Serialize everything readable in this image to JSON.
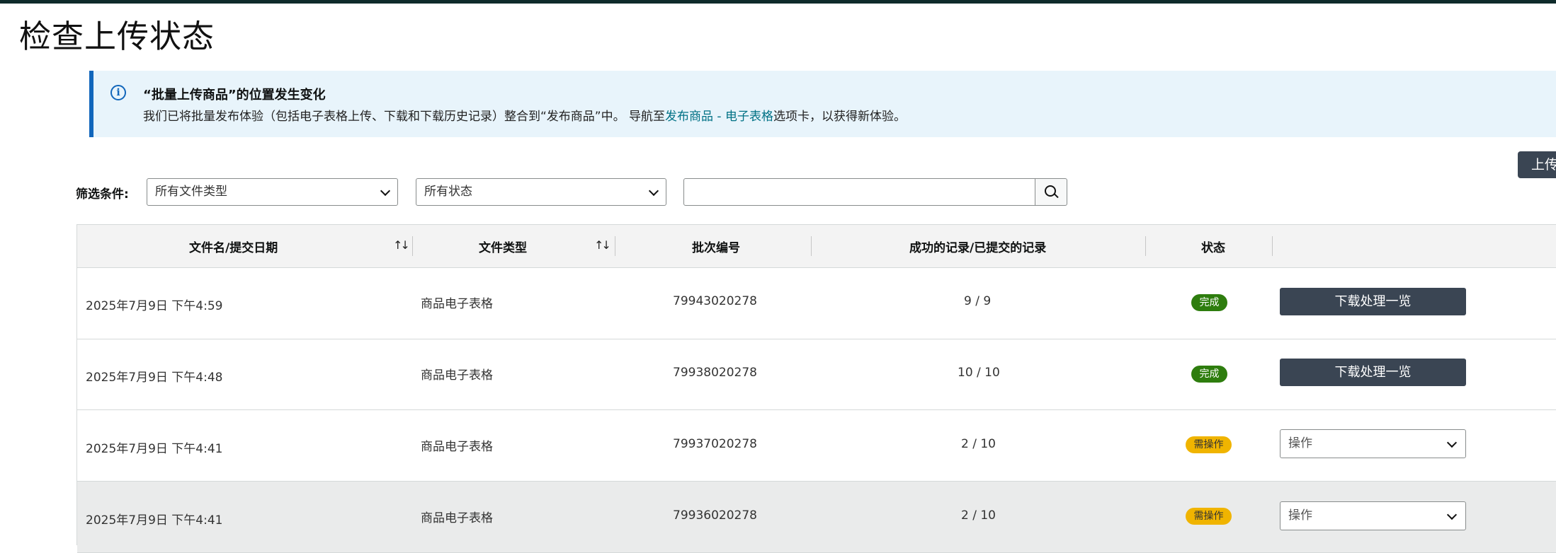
{
  "page": {
    "title": "检查上传状态"
  },
  "banner": {
    "icon": "info-icon",
    "title": "“批量上传商品”的位置发生变化",
    "text_before": "我们已将批量发布体验（包括电子表格上传、下载和下载历史记录）整合到“发布商品”中。 导航至",
    "link": "发布商品 - 电子表格",
    "text_after": "选项卡，以获得新体验。"
  },
  "toolbar": {
    "upload_label": "上传"
  },
  "filters": {
    "label": "筛选条件:",
    "file_type": "所有文件类型",
    "status": "所有状态",
    "search_value": ""
  },
  "table": {
    "headers": {
      "filename": "文件名/提交日期",
      "filetype": "文件类型",
      "batch": "批次编号",
      "records": "成功的记录/已提交的记录",
      "status": "状态"
    },
    "rows": [
      {
        "date": "2025年7月9日 下午4:59",
        "type": "商品电子表格",
        "batch": "79943020278",
        "records": "9 / 9",
        "status": "完成",
        "action": "下载处理一览"
      },
      {
        "date": "2025年7月9日 下午4:48",
        "type": "商品电子表格",
        "batch": "79938020278",
        "records": "10 / 10",
        "status": "完成",
        "action": "下载处理一览"
      },
      {
        "date": "2025年7月9日 下午4:41",
        "type": "商品电子表格",
        "batch": "79937020278",
        "records": "2 / 10",
        "status": "需操作",
        "action": "操作"
      },
      {
        "date": "2025年7月9日 下午4:41",
        "type": "商品电子表格",
        "batch": "79936020278",
        "records": "2 / 10",
        "status": "需操作",
        "action": "操作"
      }
    ]
  },
  "colors": {
    "done": "#2e7d0e",
    "need_action": "#f0b400",
    "button": "#3a4553",
    "link": "#007185",
    "banner_accent": "#1166bb"
  }
}
